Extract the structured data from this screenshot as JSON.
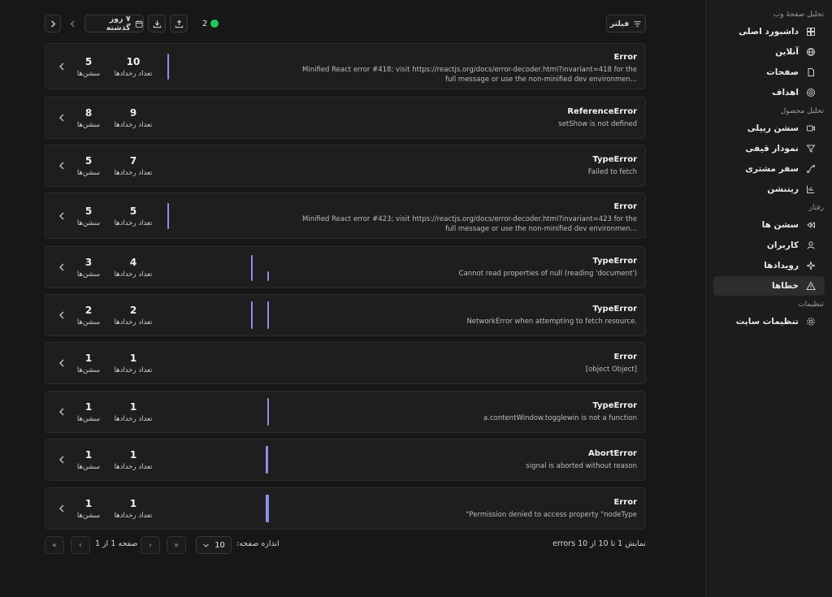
{
  "sidebar": {
    "sections": [
      {
        "title": "تحلیل صفحهٔ وب",
        "items": [
          {
            "label": "داشبورد اصلی",
            "icon": "dashboard-icon"
          },
          {
            "label": "آنلاین",
            "icon": "globe-icon"
          },
          {
            "label": "صفحات",
            "icon": "page-icon"
          },
          {
            "label": "اهداف",
            "icon": "target-icon"
          }
        ]
      },
      {
        "title": "تحلیل محصول",
        "items": [
          {
            "label": "سشن ریپلی",
            "icon": "video-icon"
          },
          {
            "label": "نمودار قیفی",
            "icon": "funnel-icon"
          },
          {
            "label": "سفر مشتری",
            "icon": "journey-icon"
          },
          {
            "label": "ریتنشن",
            "icon": "retention-icon"
          }
        ]
      },
      {
        "title": "رفتار",
        "items": [
          {
            "label": "سشن ها",
            "icon": "rewind-icon"
          },
          {
            "label": "کاربران",
            "icon": "user-icon"
          },
          {
            "label": "رویدادها",
            "icon": "sparkle-icon"
          },
          {
            "label": "خطاها",
            "icon": "warning-icon",
            "active": true
          }
        ]
      },
      {
        "title": "تنظیمات",
        "items": [
          {
            "label": "تنظیمات سایت",
            "icon": "gear-icon"
          }
        ]
      }
    ]
  },
  "toolbar": {
    "filter_label": "فیلتر",
    "date_range_label": "۷ روز گذشته",
    "online_count": "2"
  },
  "stat_labels": {
    "events": "تعداد رخدادها",
    "sessions": "سشن‌ها"
  },
  "errors": [
    {
      "name": "Error",
      "message": "Minified React error #418; visit https://reactjs.org/docs/error-decoder.html?invariant=418 for the full message or use the non-minified dev environmen...",
      "events": "10",
      "sessions": "5"
    },
    {
      "name": "ReferenceError",
      "message": "setShow is not defined",
      "events": "9",
      "sessions": "8"
    },
    {
      "name": "TypeError",
      "message": "Failed to fetch",
      "events": "7",
      "sessions": "5"
    },
    {
      "name": "Error",
      "message": "Minified React error #423; visit https://reactjs.org/docs/error-decoder.html?invariant=423 for the full message or use the non-minified dev environmen...",
      "events": "5",
      "sessions": "5"
    },
    {
      "name": "TypeError",
      "message": "Cannot read properties of null (reading 'document')",
      "events": "4",
      "sessions": "3"
    },
    {
      "name": "TypeError",
      "message": "NetworkError when attempting to fetch resource.",
      "events": "2",
      "sessions": "2"
    },
    {
      "name": "Error",
      "message": "[object Object]",
      "events": "1",
      "sessions": "1"
    },
    {
      "name": "TypeError",
      "message": "a.contentWindow.togglewin is not a function",
      "events": "1",
      "sessions": "1"
    },
    {
      "name": "AbortError",
      "message": "signal is aborted without reason",
      "events": "1",
      "sessions": "1"
    },
    {
      "name": "Error",
      "message": "\"Permission denied to access property \"nodeType",
      "events": "1",
      "sessions": "1"
    }
  ],
  "pagination": {
    "summary": "نمایش 1 تا 10 از 10 errors",
    "page_size_label": "اندازه صفحه:",
    "page_size": "10",
    "page_info": "صفحه 1 از 1"
  }
}
